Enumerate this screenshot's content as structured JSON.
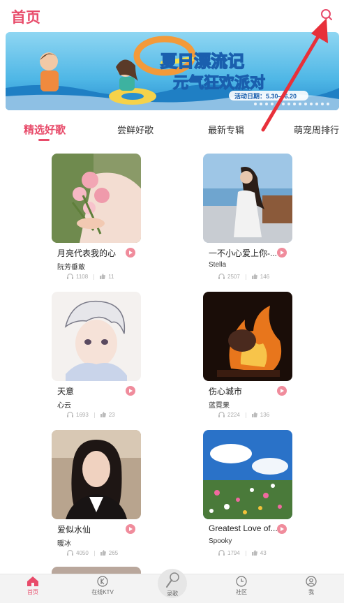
{
  "header": {
    "title": "首页",
    "search_icon": "search-icon"
  },
  "banner": {
    "title_line1": "夏日漂流记",
    "title_line2": "元气狂欢派对",
    "date_text": "活动日期：5.30—6.20"
  },
  "tabs": [
    {
      "label": "精选好歌",
      "active": true
    },
    {
      "label": "尝鲜好歌",
      "active": false
    },
    {
      "label": "最新专辑",
      "active": false
    },
    {
      "label": "萌宠周排行",
      "active": false
    }
  ],
  "songs": [
    {
      "title": "月亮代表我的心",
      "artist": "阮芳垂敢",
      "plays": "1108",
      "likes": "11"
    },
    {
      "title": "一不小心爱上你-...",
      "artist": "Stella",
      "plays": "2507",
      "likes": "146"
    },
    {
      "title": "天意",
      "artist": "心云",
      "plays": "1693",
      "likes": "23"
    },
    {
      "title": "伤心城市",
      "artist": "蓝霓果",
      "plays": "2224",
      "likes": "136"
    },
    {
      "title": "爱似水仙",
      "artist": "暖冰",
      "plays": "4050",
      "likes": "265"
    },
    {
      "title": "Greatest Love of...",
      "artist": "Spooky",
      "plays": "1794",
      "likes": "43"
    }
  ],
  "tabbar": [
    {
      "label": "首页",
      "icon": "home-icon",
      "active": true
    },
    {
      "label": "在线KTV",
      "icon": "ktv-icon",
      "active": false
    },
    {
      "label": "录歌",
      "icon": "microphone-icon",
      "active": false
    },
    {
      "label": "社区",
      "icon": "community-icon",
      "active": false
    },
    {
      "label": "我",
      "icon": "profile-icon",
      "active": false
    }
  ],
  "colors": {
    "accent": "#e84b6a",
    "tabbar_bg": "#f3f3f3",
    "annotation_arrow": "#e8303a"
  }
}
